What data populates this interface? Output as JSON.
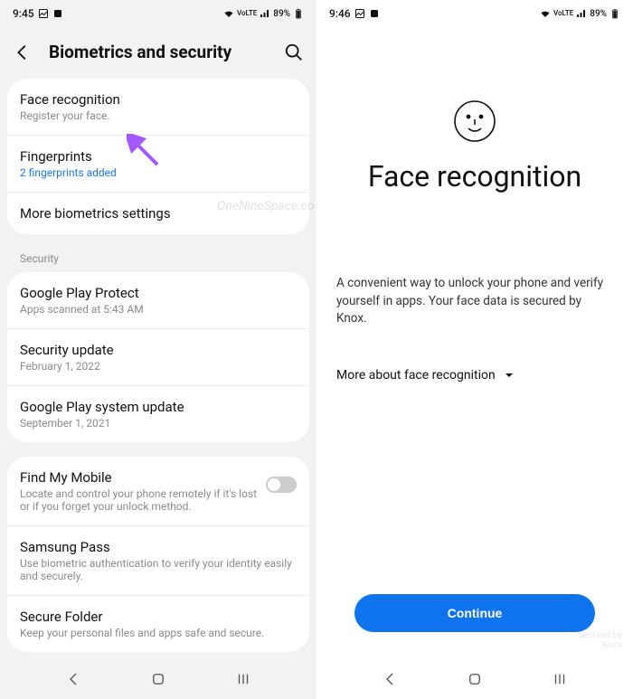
{
  "left": {
    "status": {
      "time": "9:45",
      "battery": "89%",
      "lte": "VoLTE"
    },
    "header": {
      "title": "Biometrics and security"
    },
    "biometrics": {
      "face": {
        "title": "Face recognition",
        "sub": "Register your face."
      },
      "finger": {
        "title": "Fingerprints",
        "sub": "2 fingerprints added"
      },
      "more": {
        "title": "More biometrics settings"
      }
    },
    "security_label": "Security",
    "security": {
      "play_protect": {
        "title": "Google Play Protect",
        "sub": "Apps scanned at 5:43 AM"
      },
      "update": {
        "title": "Security update",
        "sub": "February 1, 2022"
      },
      "system_update": {
        "title": "Google Play system update",
        "sub": "September 1, 2021"
      }
    },
    "other": {
      "find": {
        "title": "Find My Mobile",
        "sub": "Locate and control your phone remotely if it's lost or if you forget your unlock method."
      },
      "pass": {
        "title": "Samsung Pass",
        "sub": "Use biometric authentication to verify your identity easily and securely."
      },
      "folder": {
        "title": "Secure Folder",
        "sub": "Keep your personal files and apps safe and secure."
      }
    },
    "watermark": "OneNineSpace.co"
  },
  "right": {
    "status": {
      "time": "9:46",
      "battery": "89%",
      "lte": "VoLTE"
    },
    "title": "Face recognition",
    "desc": "A convenient way to unlock your phone and verify yourself in apps. Your face data is secured by Knox.",
    "more": "More about face recognition",
    "continue": "Continue",
    "knox1": "Secured by",
    "knox2": "Knox"
  }
}
